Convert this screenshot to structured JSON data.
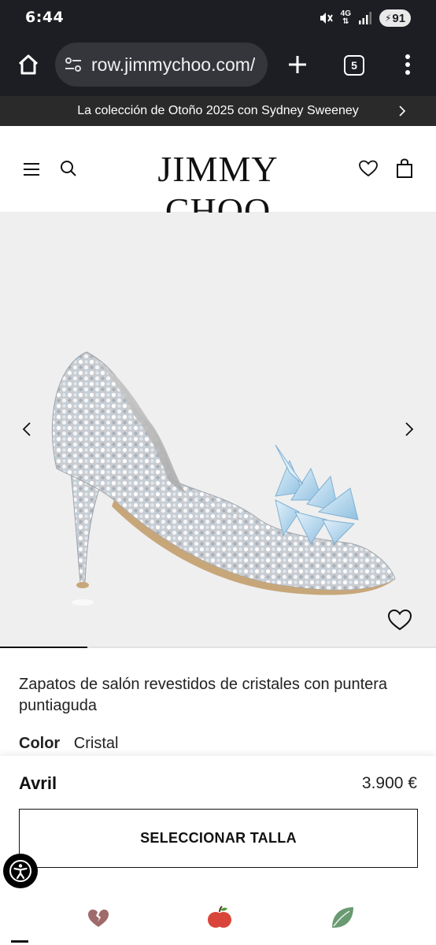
{
  "status_bar": {
    "time": "6:44",
    "network": "4G",
    "battery": "91",
    "icons": [
      "mute-icon",
      "signal-icon",
      "battery-icon"
    ]
  },
  "browser": {
    "url": "row.jimmychoo.com/",
    "tab_count": "5",
    "icons": [
      "home-icon",
      "site-settings-icon",
      "new-tab-icon",
      "tab-switcher-icon",
      "more-menu-icon"
    ]
  },
  "promo": {
    "text": "La colección de Otoño 2025 con Sydney Sweeney"
  },
  "header": {
    "logo": "JIMMY CHOO",
    "icons": [
      "menu-icon",
      "search-icon",
      "wishlist-icon",
      "bag-icon"
    ]
  },
  "gallery": {
    "image_count_progress": 0.2,
    "background": "#efefef",
    "icons": [
      "chevron-left-icon",
      "chevron-right-icon",
      "heart-icon"
    ]
  },
  "product": {
    "title": "Zapatos de salón revestidos de cristales con puntera puntiaguda",
    "color_label": "Color",
    "color_value": "Cristal",
    "name": "Avril",
    "price": "3.900 €",
    "select_size_label": "SELECCIONAR TALLA"
  },
  "bottom_icons": [
    "broken-heart-icon",
    "apple-icon",
    "leaf-icon"
  ],
  "colors": {
    "browser_bg": "#1d1e23",
    "url_pill": "#35363c",
    "promo_bg": "#2a2a2a",
    "text": "#111111"
  }
}
